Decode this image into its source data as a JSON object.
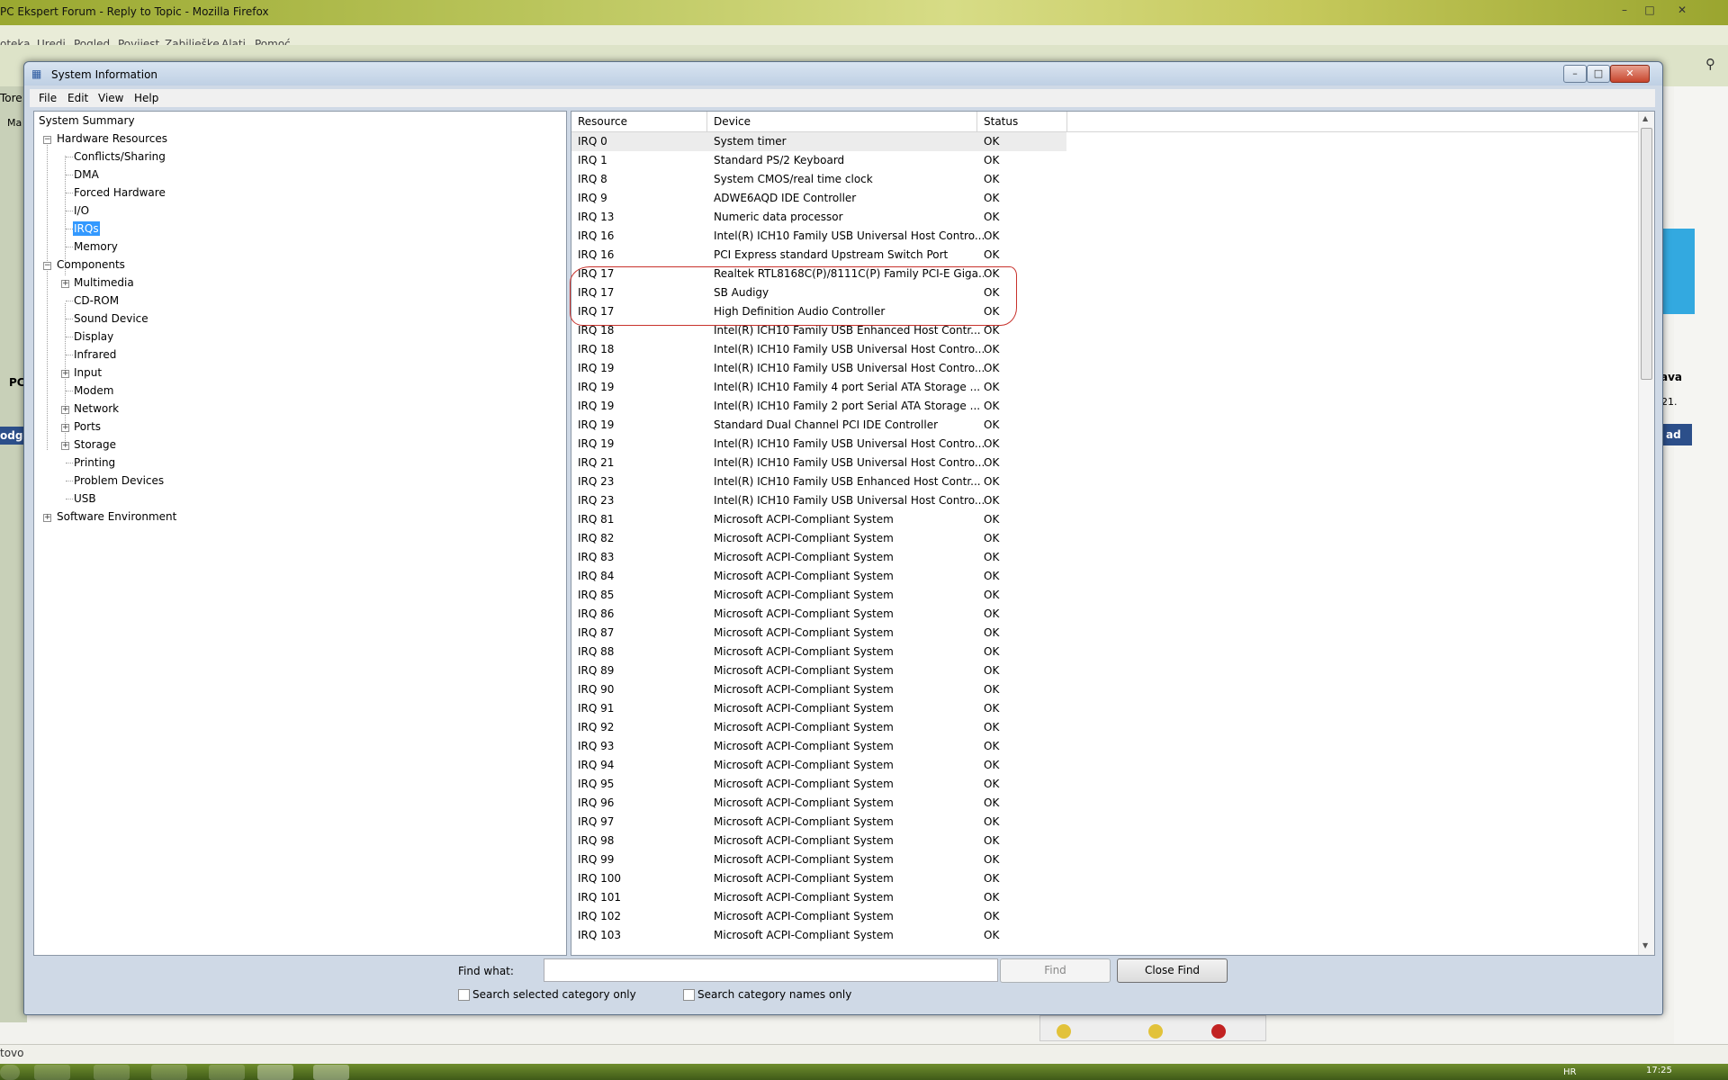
{
  "firefox": {
    "title": "PC Ekspert Forum - Reply to Topic - Mozilla Firefox",
    "menu": [
      "oteka",
      "Uredi",
      "Pogled",
      "Povijest",
      "Zabilješke",
      "Alati",
      "Pomoć"
    ],
    "status_text": "tovo",
    "side_labels": {
      "tab_left": "Tore",
      "tab_left2": "Ma",
      "pc": "PC",
      "odgo": "odgo",
      "ava": "ava",
      "num": "21.",
      "ad": "ad"
    }
  },
  "taskbar": {
    "lang": "HR",
    "clock": "17:25"
  },
  "window": {
    "title": "System Information",
    "menu": [
      "File",
      "Edit",
      "View",
      "Help"
    ]
  },
  "tree": {
    "system_summary": "System Summary",
    "hardware_resources": "Hardware Resources",
    "hw_children": [
      "Conflicts/Sharing",
      "DMA",
      "Forced Hardware",
      "I/O",
      "IRQs",
      "Memory"
    ],
    "components": "Components",
    "comp_children": [
      "Multimedia",
      "CD-ROM",
      "Sound Device",
      "Display",
      "Infrared",
      "Input",
      "Modem",
      "Network",
      "Ports",
      "Storage",
      "Printing",
      "Problem Devices",
      "USB"
    ],
    "software_environment": "Software Environment",
    "selected": "IRQs"
  },
  "list": {
    "headers": {
      "resource": "Resource",
      "device": "Device",
      "status": "Status"
    },
    "rows": [
      [
        "IRQ 0",
        "System timer",
        "OK"
      ],
      [
        "IRQ 1",
        "Standard PS/2 Keyboard",
        "OK"
      ],
      [
        "IRQ 8",
        "System CMOS/real time clock",
        "OK"
      ],
      [
        "IRQ 9",
        "ADWE6AQD IDE Controller",
        "OK"
      ],
      [
        "IRQ 13",
        "Numeric data processor",
        "OK"
      ],
      [
        "IRQ 16",
        "Intel(R) ICH10 Family USB Universal Host Contro...",
        "OK"
      ],
      [
        "IRQ 16",
        "PCI Express standard Upstream Switch Port",
        "OK"
      ],
      [
        "IRQ 17",
        "Realtek RTL8168C(P)/8111C(P) Family PCI-E Giga...",
        "OK"
      ],
      [
        "IRQ 17",
        "SB Audigy",
        "OK"
      ],
      [
        "IRQ 17",
        "High Definition Audio Controller",
        "OK"
      ],
      [
        "IRQ 18",
        "Intel(R) ICH10 Family USB Enhanced Host Contr...",
        "OK"
      ],
      [
        "IRQ 18",
        "Intel(R) ICH10 Family USB Universal Host Contro...",
        "OK"
      ],
      [
        "IRQ 19",
        "Intel(R) ICH10 Family USB Universal Host Contro...",
        "OK"
      ],
      [
        "IRQ 19",
        "Intel(R) ICH10 Family 4 port Serial ATA Storage ...",
        "OK"
      ],
      [
        "IRQ 19",
        "Intel(R) ICH10 Family 2 port Serial ATA Storage ...",
        "OK"
      ],
      [
        "IRQ 19",
        "Standard Dual Channel PCI IDE Controller",
        "OK"
      ],
      [
        "IRQ 19",
        "Intel(R) ICH10 Family USB Universal Host Contro...",
        "OK"
      ],
      [
        "IRQ 21",
        "Intel(R) ICH10 Family USB Universal Host Contro...",
        "OK"
      ],
      [
        "IRQ 23",
        "Intel(R) ICH10 Family USB Enhanced Host Contr...",
        "OK"
      ],
      [
        "IRQ 23",
        "Intel(R) ICH10 Family USB Universal Host Contro...",
        "OK"
      ],
      [
        "IRQ 81",
        "Microsoft ACPI-Compliant System",
        "OK"
      ],
      [
        "IRQ 82",
        "Microsoft ACPI-Compliant System",
        "OK"
      ],
      [
        "IRQ 83",
        "Microsoft ACPI-Compliant System",
        "OK"
      ],
      [
        "IRQ 84",
        "Microsoft ACPI-Compliant System",
        "OK"
      ],
      [
        "IRQ 85",
        "Microsoft ACPI-Compliant System",
        "OK"
      ],
      [
        "IRQ 86",
        "Microsoft ACPI-Compliant System",
        "OK"
      ],
      [
        "IRQ 87",
        "Microsoft ACPI-Compliant System",
        "OK"
      ],
      [
        "IRQ 88",
        "Microsoft ACPI-Compliant System",
        "OK"
      ],
      [
        "IRQ 89",
        "Microsoft ACPI-Compliant System",
        "OK"
      ],
      [
        "IRQ 90",
        "Microsoft ACPI-Compliant System",
        "OK"
      ],
      [
        "IRQ 91",
        "Microsoft ACPI-Compliant System",
        "OK"
      ],
      [
        "IRQ 92",
        "Microsoft ACPI-Compliant System",
        "OK"
      ],
      [
        "IRQ 93",
        "Microsoft ACPI-Compliant System",
        "OK"
      ],
      [
        "IRQ 94",
        "Microsoft ACPI-Compliant System",
        "OK"
      ],
      [
        "IRQ 95",
        "Microsoft ACPI-Compliant System",
        "OK"
      ],
      [
        "IRQ 96",
        "Microsoft ACPI-Compliant System",
        "OK"
      ],
      [
        "IRQ 97",
        "Microsoft ACPI-Compliant System",
        "OK"
      ],
      [
        "IRQ 98",
        "Microsoft ACPI-Compliant System",
        "OK"
      ],
      [
        "IRQ 99",
        "Microsoft ACPI-Compliant System",
        "OK"
      ],
      [
        "IRQ 100",
        "Microsoft ACPI-Compliant System",
        "OK"
      ],
      [
        "IRQ 101",
        "Microsoft ACPI-Compliant System",
        "OK"
      ],
      [
        "IRQ 102",
        "Microsoft ACPI-Compliant System",
        "OK"
      ],
      [
        "IRQ 103",
        "Microsoft ACPI-Compliant System",
        "OK"
      ]
    ]
  },
  "find": {
    "label": "Find what:",
    "value": "",
    "find_button": "Find",
    "close_button": "Close Find",
    "search_selected": "Search selected category only",
    "search_names": "Search category names only"
  },
  "colors": {
    "selection": "#3399ff",
    "highlight_oval": "#c8322c",
    "window_frame": "#cfd9e6"
  }
}
